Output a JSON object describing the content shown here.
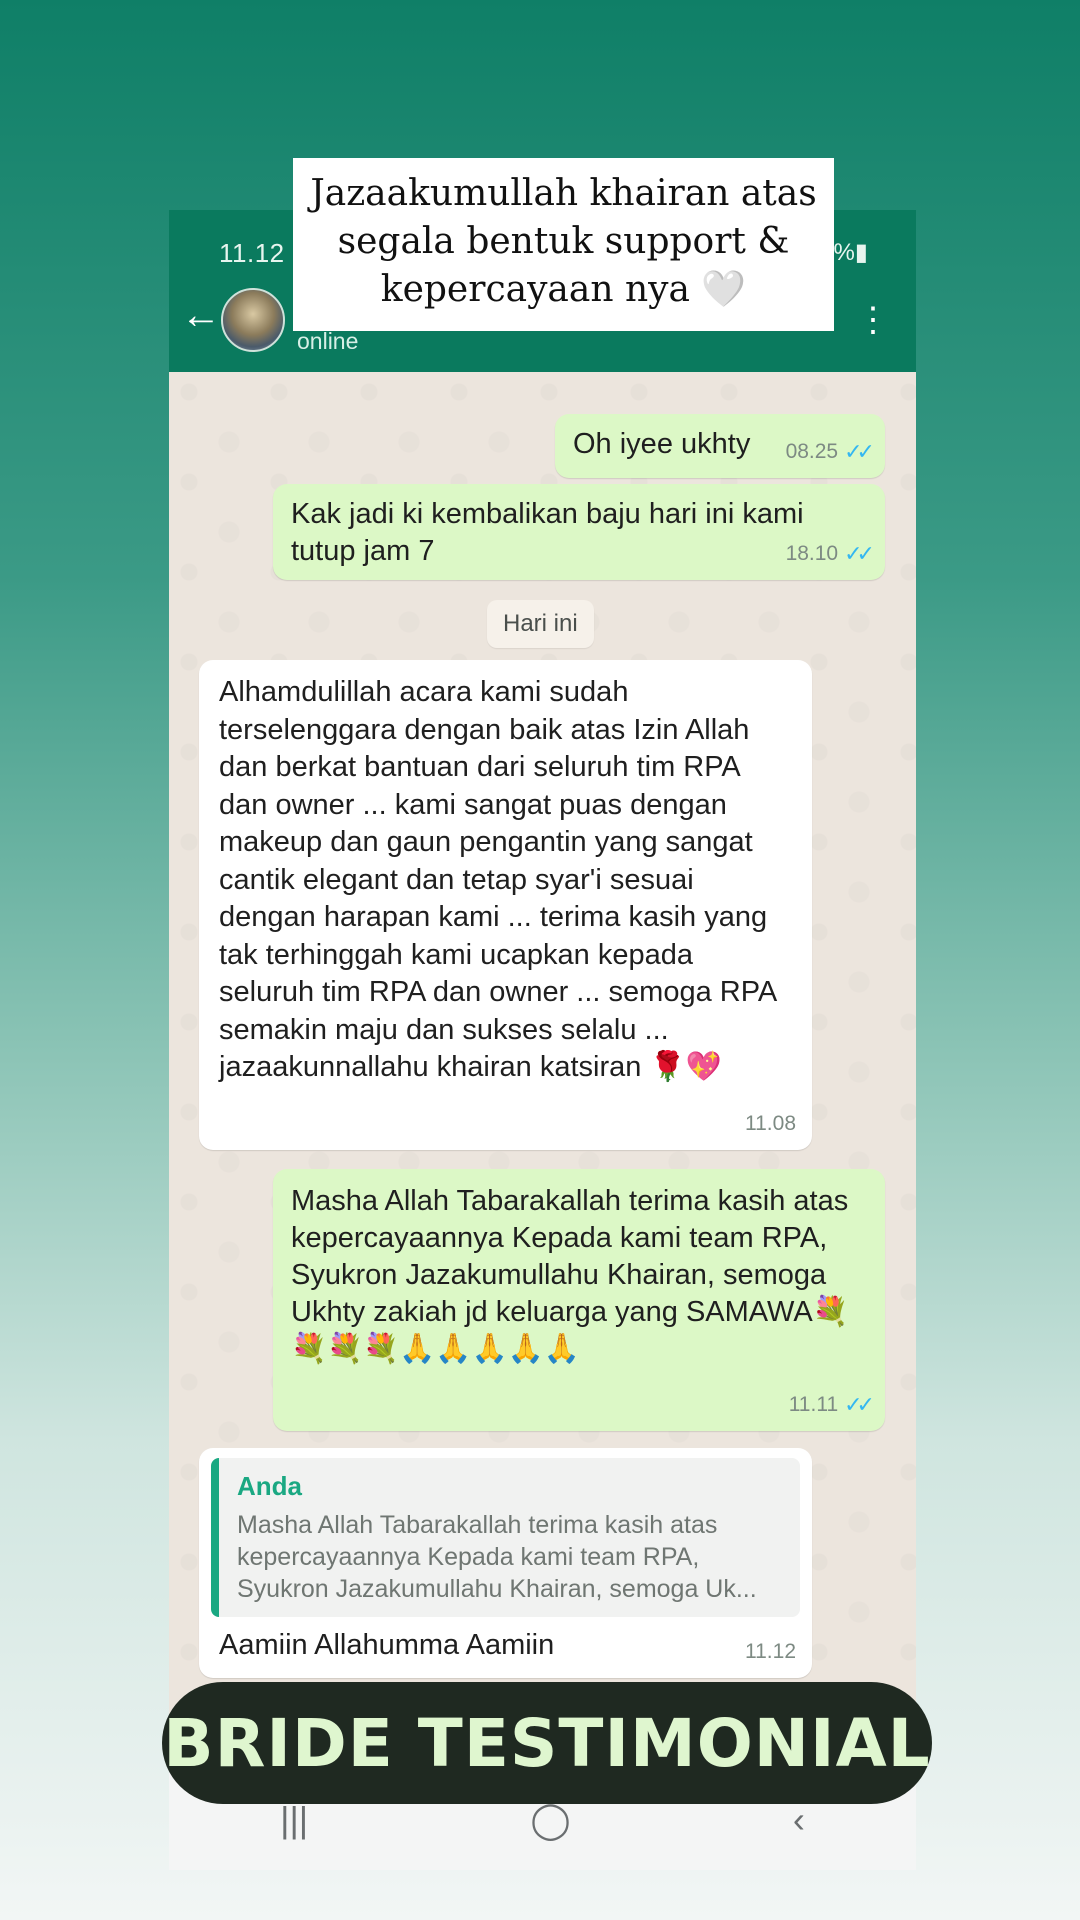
{
  "caption": {
    "lines": [
      "Jazaakumullah khairan atas",
      "segala bentuk support &",
      "kepercayaan nya 🤍"
    ]
  },
  "status_bar": {
    "time": "11.12",
    "battery": "%▮"
  },
  "header": {
    "presence": "online",
    "back_icon": "back-arrow-icon",
    "menu_icon": "more-vert-icon"
  },
  "messages": [
    {
      "direction": "out",
      "text": "Oh iyee ukhty",
      "time": "08.25",
      "ticks": "✓✓"
    },
    {
      "direction": "out",
      "text": "Kak jadi ki kembalikan baju hari ini kami tutup jam 7",
      "time": "18.10",
      "ticks": "✓✓"
    },
    {
      "direction": "in",
      "text": "Alhamdulillah acara kami sudah terselenggara dengan baik atas Izin Allah dan berkat bantuan dari seluruh tim RPA dan owner ... kami sangat puas dengan makeup dan gaun pengantin yang sangat cantik elegant dan tetap syar'i sesuai dengan harapan kami ... terima kasih yang tak terhinggah kami ucapkan  kepada seluruh tim RPA dan owner ... semoga RPA semakin maju dan sukses selalu ... jazaakunnallahu khairan katsiran 🌹💖",
      "time": "11.08"
    },
    {
      "direction": "out",
      "text": "Masha Allah Tabarakallah terima kasih atas kepercayaannya Kepada kami team RPA, Syukron Jazakumullahu Khairan, semoga Ukhty zakiah jd keluarga yang SAMAWA💐💐💐💐🙏🙏🙏🙏🙏",
      "time": "11.11",
      "ticks": "✓✓"
    },
    {
      "direction": "in",
      "quote_author": "Anda",
      "quote_text": "Masha Allah Tabarakallah terima kasih atas kepercayaannya Kepada kami team RPA, Syukron Jazakumullahu Khairan, semoga Uk...",
      "text": "Aamiin Allahumma Aamiin",
      "time": "11.12"
    }
  ],
  "date_chip": "Hari ini",
  "nav": {
    "recents": "|||",
    "home": "◯",
    "back": "‹"
  },
  "badge": "BRIDE TESTIMONIAL"
}
